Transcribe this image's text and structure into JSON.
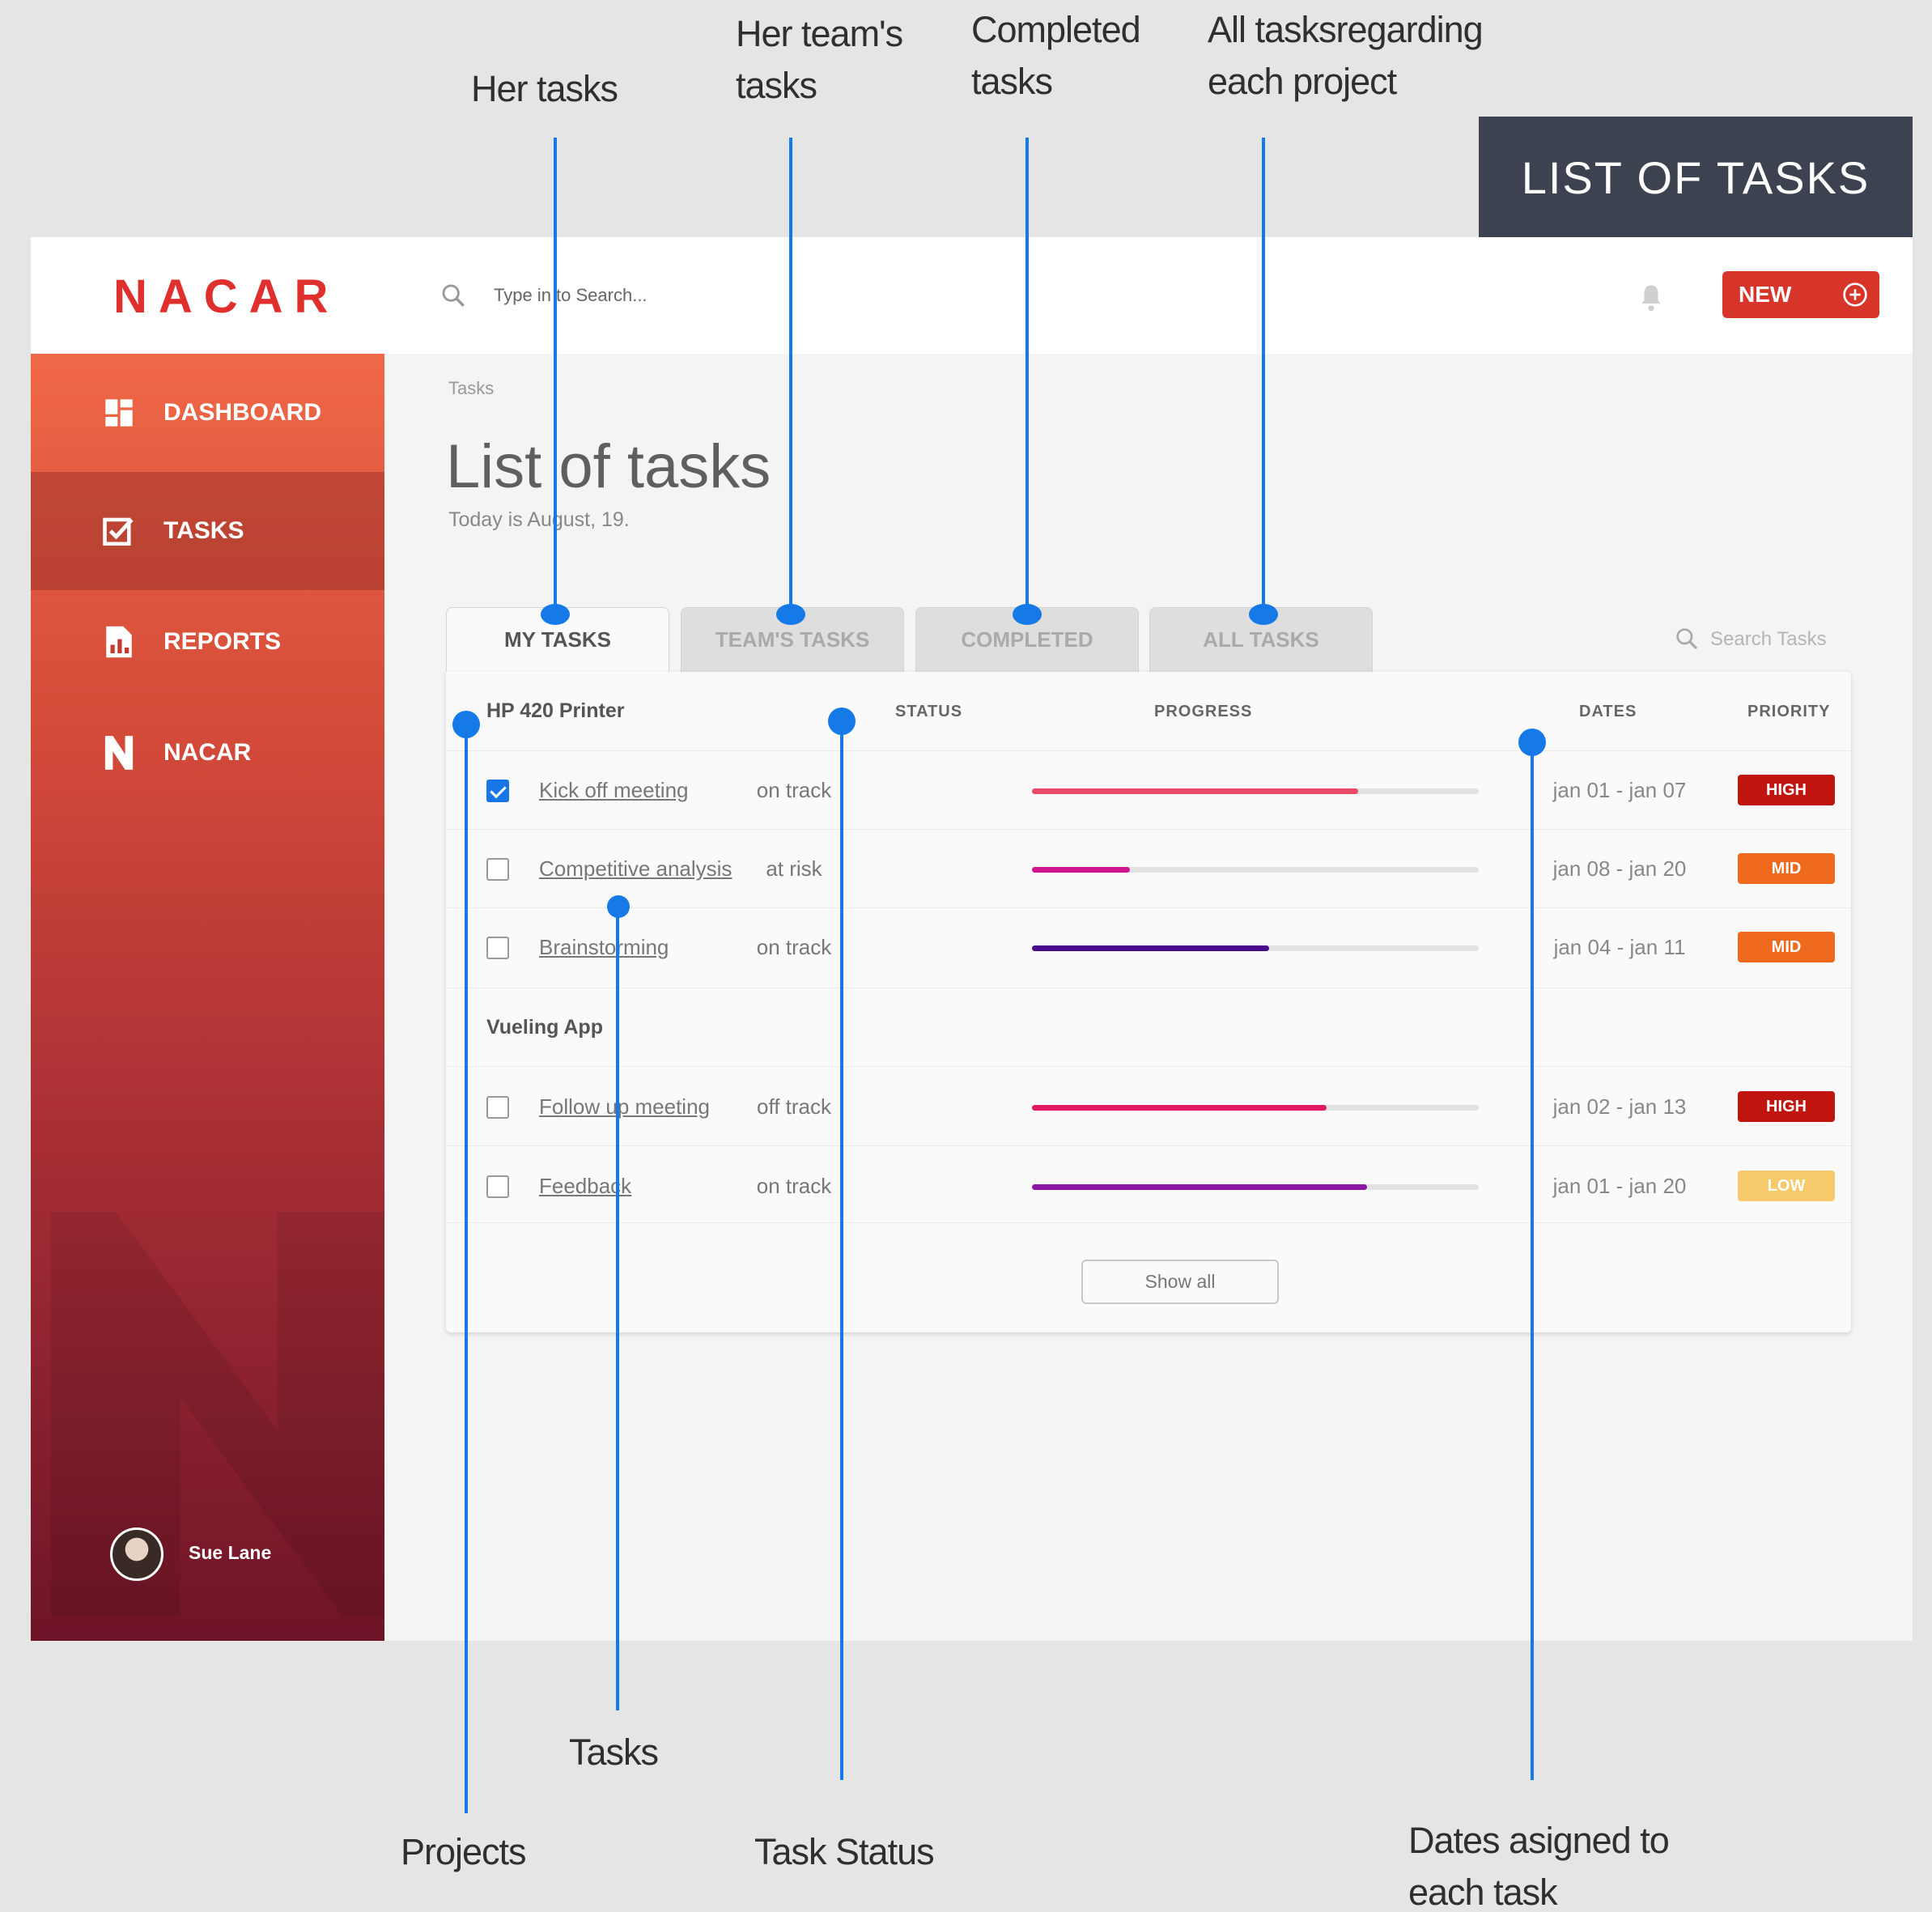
{
  "header_label": "LIST OF TASKS",
  "app": {
    "logo": "NACAR",
    "search": {
      "placeholder": "Type in to Search..."
    },
    "new_button": "NEW",
    "sidebar": {
      "items": [
        {
          "label": "DASHBOARD",
          "icon": "dashboard-icon"
        },
        {
          "label": "TASKS",
          "icon": "checkbox-icon",
          "active": true
        },
        {
          "label": "REPORTS",
          "icon": "report-icon"
        },
        {
          "label": "NACAR",
          "icon": "n-logo-icon"
        }
      ],
      "user": "Sue Lane"
    },
    "main": {
      "breadcrumb": "Tasks",
      "title": "List of tasks",
      "subtitle": "Today is August, 19.",
      "tabs": [
        {
          "label": "MY TASKS",
          "active": true
        },
        {
          "label": "TEAM'S TASKS"
        },
        {
          "label": "COMPLETED"
        },
        {
          "label": "ALL TASKS"
        }
      ],
      "task_search_placeholder": "Search Tasks",
      "columns": {
        "status": "STATUS",
        "progress": "PROGRESS",
        "dates": "DATES",
        "priority": "PRIORITY"
      },
      "projects": [
        {
          "name": "HP 420 Printer",
          "tasks": [
            {
              "name": "Kick off meeting",
              "checked": true,
              "status": "on track",
              "progress": 0.73,
              "color": "#e94a68",
              "dates": "jan 01 - jan 07",
              "priority": "HIGH",
              "priority_color": "#c0140f"
            },
            {
              "name": "Competitive analysis",
              "checked": false,
              "status": "at risk",
              "progress": 0.22,
              "color": "#d0148f",
              "dates": "jan 08 - jan 20",
              "priority": "MID",
              "priority_color": "#ef6a1f"
            },
            {
              "name": "Brainstorming",
              "checked": false,
              "status": "on track",
              "progress": 0.53,
              "color": "#4a0a8c",
              "dates": "jan 04 - jan 11",
              "priority": "MID",
              "priority_color": "#ef6a1f"
            }
          ]
        },
        {
          "name": "Vueling App",
          "tasks": [
            {
              "name": "Follow up meeting",
              "checked": false,
              "status": "off track",
              "progress": 0.66,
              "color": "#e01a62",
              "dates": "jan 02 - jan 13",
              "priority": "HIGH",
              "priority_color": "#c0140f"
            },
            {
              "name": "Feedback",
              "checked": false,
              "status": "on track",
              "progress": 0.75,
              "color": "#8c16a6",
              "dates": "jan 01 - jan 20",
              "priority": "LOW",
              "priority_color": "#f6c96b"
            }
          ]
        }
      ],
      "show_all": "Show all"
    }
  },
  "annotations": {
    "her_tasks": "Her tasks",
    "team_tasks_1": "Her team's",
    "team_tasks_2": "tasks",
    "completed_1": "Completed",
    "completed_2": "tasks",
    "all_tasks_1": "All tasksregarding",
    "all_tasks_2": "each project",
    "projects": "Projects",
    "tasks": "Tasks",
    "task_status": "Task Status",
    "dates_1": "Dates asigned to",
    "dates_2": "each task"
  },
  "colors": {
    "accent": "#1579e8",
    "brand": "#e0302e",
    "header_box": "#3c4250"
  }
}
